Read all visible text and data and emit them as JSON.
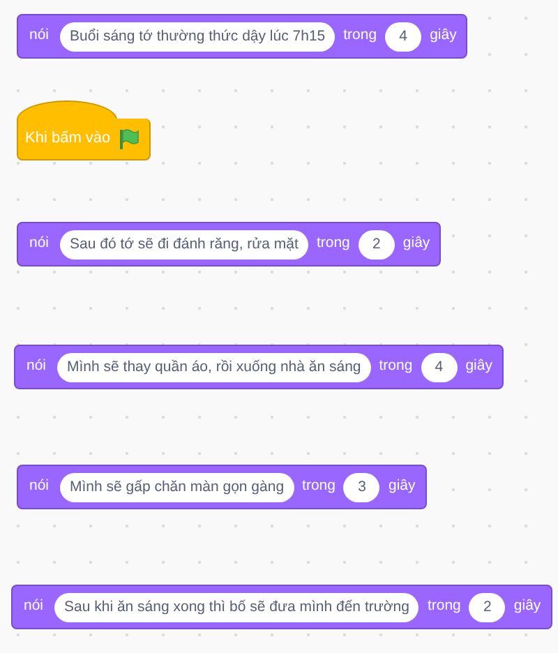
{
  "scripts": [
    {
      "kind": "say",
      "verb": "nói",
      "message": "Buổi sáng tớ thường thức dậy lúc 7h15",
      "connector": "trong",
      "seconds": "4",
      "unit": "giây"
    },
    {
      "kind": "hat",
      "label": "Khi bấm vào"
    },
    {
      "kind": "say",
      "verb": "nói",
      "message": "Sau đó tớ sẽ đi đánh răng, rửa mặt",
      "connector": "trong",
      "seconds": "2",
      "unit": "giây"
    },
    {
      "kind": "say",
      "verb": "nói",
      "message": "Mình sẽ thay quần áo, rồi xuống nhà ăn sáng",
      "connector": "trong",
      "seconds": "4",
      "unit": "giây"
    },
    {
      "kind": "say",
      "verb": "nói",
      "message": "Mình sẽ gấp chăn màn gọn gàng",
      "connector": "trong",
      "seconds": "3",
      "unit": "giây"
    },
    {
      "kind": "say",
      "verb": "nói",
      "message": "Sau khi ăn sáng xong thì bố sẽ đưa mình đến trường",
      "connector": "trong",
      "seconds": "2",
      "unit": "giây"
    }
  ]
}
